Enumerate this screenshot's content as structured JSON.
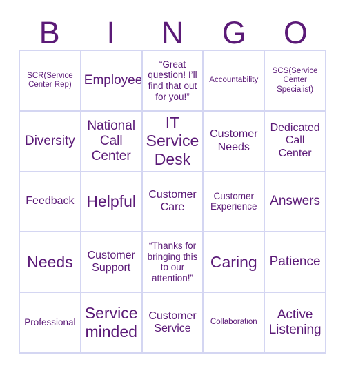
{
  "card": {
    "header_letters": [
      "B",
      "I",
      "N",
      "G",
      "O"
    ],
    "text_color": "#5b1a77",
    "grid_line_color": "#d4d6f2",
    "background_color": "#ffffff",
    "columns": 5,
    "rows": 5
  },
  "cells": [
    {
      "text": "SCR(Service Center Rep)",
      "size": "xs"
    },
    {
      "text": "Employee",
      "size": "l"
    },
    {
      "text": "“Great question! I’ll find that out for you!”",
      "size": "s"
    },
    {
      "text": "Accountability",
      "size": "xs"
    },
    {
      "text": "SCS(Service Center Specialist)",
      "size": "xs"
    },
    {
      "text": "Diversity",
      "size": "l"
    },
    {
      "text": "National Call Center",
      "size": "l"
    },
    {
      "text": "IT Service Desk",
      "size": "xl"
    },
    {
      "text": "Customer Needs",
      "size": "m"
    },
    {
      "text": "Dedicated Call Center",
      "size": "m"
    },
    {
      "text": "Feedback",
      "size": "m"
    },
    {
      "text": "Helpful",
      "size": "xl"
    },
    {
      "text": "Customer Care",
      "size": "m"
    },
    {
      "text": "Customer Experience",
      "size": "s"
    },
    {
      "text": "Answers",
      "size": "l"
    },
    {
      "text": "Needs",
      "size": "xl"
    },
    {
      "text": "Customer Support",
      "size": "m"
    },
    {
      "text": "“Thanks for bringing this to our attention!”",
      "size": "s"
    },
    {
      "text": "Caring",
      "size": "xl"
    },
    {
      "text": "Patience",
      "size": "l"
    },
    {
      "text": "Professional",
      "size": "s"
    },
    {
      "text": "Service minded",
      "size": "xl"
    },
    {
      "text": "Customer Service",
      "size": "m"
    },
    {
      "text": "Collaboration",
      "size": "xs"
    },
    {
      "text": "Active Listening",
      "size": "l"
    }
  ]
}
